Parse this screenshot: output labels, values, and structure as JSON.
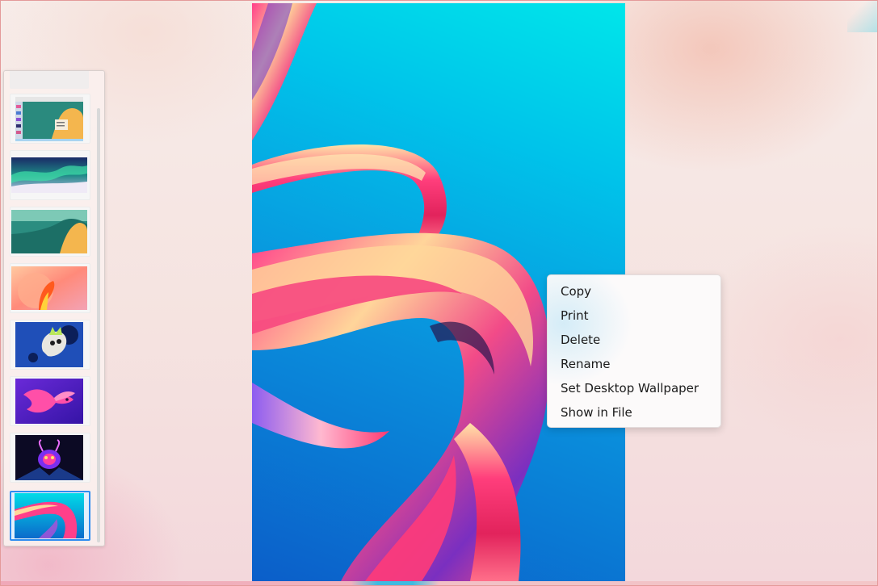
{
  "viewer": {
    "thumbnails": [
      {
        "name": "desktop-screenshot"
      },
      {
        "name": "aurora-landscape"
      },
      {
        "name": "teal-yellow-waves"
      },
      {
        "name": "orange-flower-abstract"
      },
      {
        "name": "dragon-robot-art"
      },
      {
        "name": "pink-betta-fish"
      },
      {
        "name": "neon-creature"
      },
      {
        "name": "pink-ribbon-wallpaper",
        "selected": true
      }
    ]
  },
  "context_menu": {
    "items": [
      {
        "label": "Copy"
      },
      {
        "label": "Print"
      },
      {
        "label": "Delete"
      },
      {
        "label": "Rename"
      },
      {
        "label": "Set Desktop Wallpaper"
      },
      {
        "label": "Show in File"
      }
    ]
  },
  "colors": {
    "selection_accent": "#2d8cf0",
    "image_background": "#00c3ea"
  }
}
